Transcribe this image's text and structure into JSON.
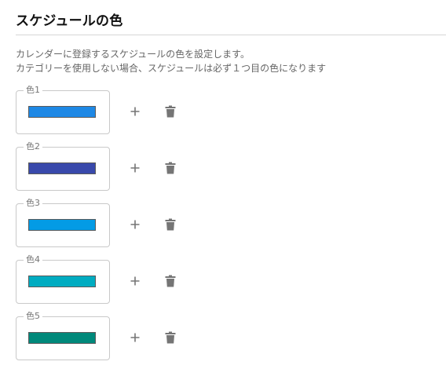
{
  "section": {
    "title": "スケジュールの色",
    "description_line1": "カレンダーに登録するスケジュールの色を設定します。",
    "description_line2": "カテゴリーを使用しない場合、スケジュールは必ず１つ目の色になります"
  },
  "colors": [
    {
      "label": "色1",
      "value": "#1e88e5"
    },
    {
      "label": "色2",
      "value": "#3949ab"
    },
    {
      "label": "色3",
      "value": "#039be5"
    },
    {
      "label": "色4",
      "value": "#00acc1"
    },
    {
      "label": "色5",
      "value": "#00897b"
    }
  ],
  "icons": {
    "add": "plus-icon",
    "delete": "trash-icon",
    "icon_color": "#757575"
  }
}
